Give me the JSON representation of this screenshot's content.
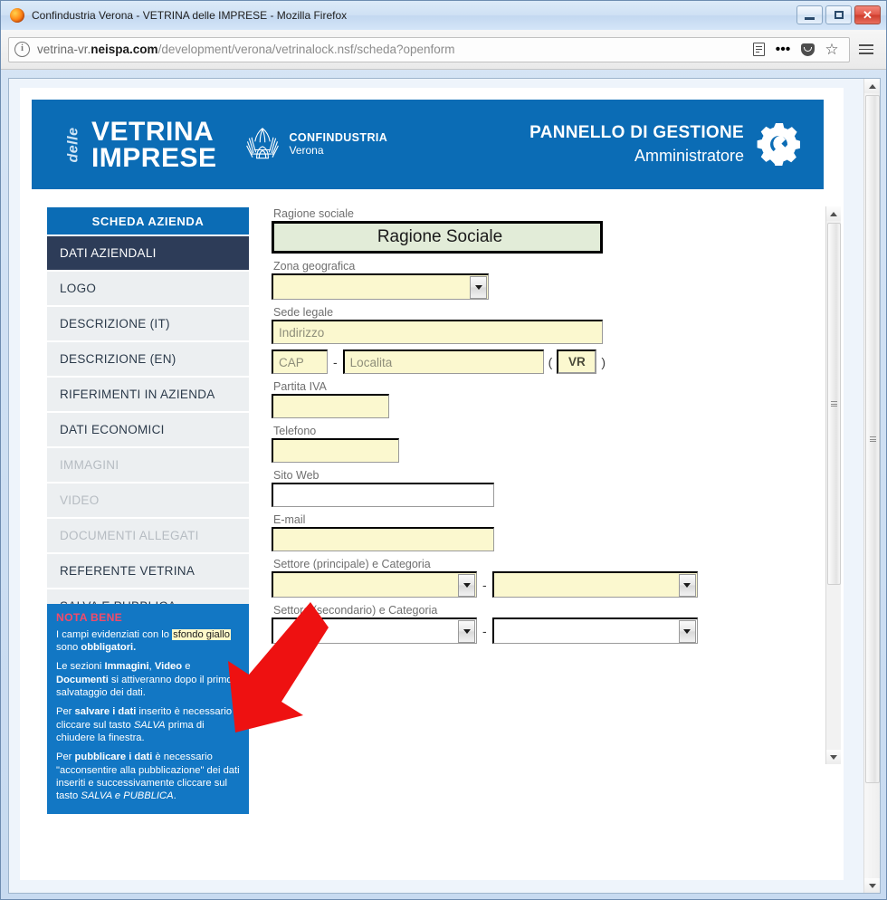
{
  "window": {
    "title": "Confindustria Verona - VETRINA delle IMPRESE - Mozilla Firefox",
    "minimize_label": "Minimize",
    "maximize_label": "Maximize",
    "close_label": "✕"
  },
  "browser": {
    "url_prefix": "vetrina-vr.",
    "url_host_bold": "neispa.com",
    "url_path": "/development/verona/vetrinalock.nsf/scheda?openform",
    "info_icon": "info-icon",
    "reader_icon": "reader-view-icon",
    "more_icon": "•••",
    "pocket_icon": "pocket-icon",
    "bookmark_icon": "star-icon",
    "menu_icon": "hamburger-menu-icon"
  },
  "banner": {
    "brand_pre": "delle",
    "brand_line1": "VETRINA",
    "brand_line2": "IMPRESE",
    "partner_line1": "CONFINDUSTRIA",
    "partner_line2": "Verona",
    "panel_line1": "PANNELLO DI GESTIONE",
    "panel_line2": "Amministratore",
    "gear_icon": "gear-wrench-icon",
    "bg_color": "#0b6cb5"
  },
  "sidebar": {
    "header": "SCHEDA AZIENDA",
    "items": [
      {
        "label": "DATI AZIENDALI",
        "state": "active"
      },
      {
        "label": "LOGO",
        "state": "normal"
      },
      {
        "label": "DESCRIZIONE (IT)",
        "state": "normal"
      },
      {
        "label": "DESCRIZIONE (EN)",
        "state": "normal"
      },
      {
        "label": "RIFERIMENTI IN AZIENDA",
        "state": "normal"
      },
      {
        "label": "DATI ECONOMICI",
        "state": "normal"
      },
      {
        "label": "IMMAGINI",
        "state": "disabled"
      },
      {
        "label": "VIDEO",
        "state": "disabled"
      },
      {
        "label": "DOCUMENTI ALLEGATI",
        "state": "disabled"
      },
      {
        "label": "REFERENTE VETRINA",
        "state": "normal"
      },
      {
        "label": "SALVA E PUBBLICA",
        "state": "normal"
      }
    ]
  },
  "nota": {
    "title": "NOTA BENE",
    "p1_a": "I campi evidenziati con lo ",
    "p1_hl": "sfondo giallo",
    "p1_b": " sono ",
    "p1_bold": "obbligatori.",
    "p2_a": "Le sezioni ",
    "p2_b1": "Immagini",
    "p2_c": ", ",
    "p2_b2": "Video",
    "p2_d": " e ",
    "p2_b3": "Documenti",
    "p2_e": " si attiveranno dopo il primo salvataggio dei dati.",
    "p3_a": "Per ",
    "p3_b1": "salvare i dati",
    "p3_c": " inserito è necessario cliccare sul tasto ",
    "p3_i": "SALVA",
    "p3_d": " prima di chiudere la finestra.",
    "p4_a": "Per ",
    "p4_b1": "pubblicare i dati",
    "p4_c": " è necessario \"acconsentire alla pubblicazione\" dei dati inseriti e successivamente cliccare sul tasto ",
    "p4_i": "SALVA e PUBBLICA",
    "p4_d": "."
  },
  "form": {
    "ragione_sociale": {
      "label": "Ragione sociale",
      "value": "Ragione Sociale"
    },
    "zona_geografica": {
      "label": "Zona geografica",
      "value": ""
    },
    "sede_legale": {
      "label": "Sede legale",
      "indirizzo_placeholder": "Indirizzo",
      "cap_placeholder": "CAP",
      "localita_placeholder": "Localita",
      "provincia_value": "VR",
      "dash": "-",
      "paren_open": "(",
      "paren_close": ")"
    },
    "partita_iva": {
      "label": "Partita IVA",
      "value": ""
    },
    "telefono": {
      "label": "Telefono",
      "value": ""
    },
    "sito_web": {
      "label": "Sito Web",
      "value": ""
    },
    "email": {
      "label": "E-mail",
      "value": ""
    },
    "settore_principale": {
      "label": "Settore (principale) e Categoria",
      "settore_value": "",
      "categoria_value": "",
      "dash": "-"
    },
    "settore_secondario": {
      "label": "Settore (secondario) e Categoria",
      "settore_value": "",
      "categoria_value": "",
      "dash": "-"
    }
  },
  "annotation": {
    "arrow": "red-down-left-arrow",
    "color": "#ee1111"
  }
}
